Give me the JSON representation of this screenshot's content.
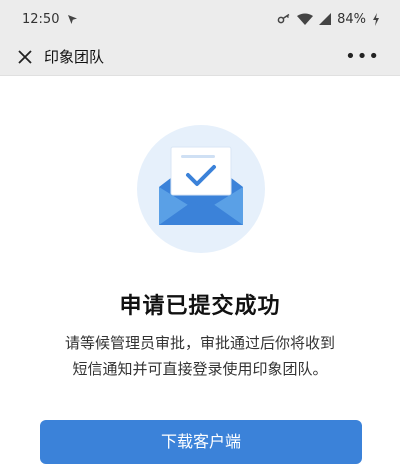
{
  "status_bar": {
    "time": "12:50",
    "battery": "84%"
  },
  "nav": {
    "title": "印象团队",
    "more": "•••"
  },
  "main": {
    "title": "申请已提交成功",
    "desc_line1": "请等候管理员审批，审批通过后你将收到",
    "desc_line2": "短信通知并可直接登录使用印象团队。",
    "button_label": "下载客户端"
  },
  "colors": {
    "accent": "#3b82d9",
    "hero_bg": "#e6f0fb"
  }
}
